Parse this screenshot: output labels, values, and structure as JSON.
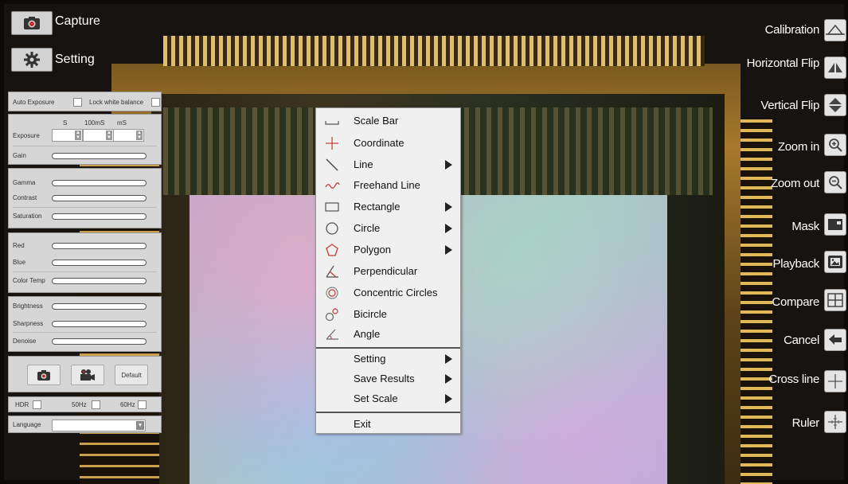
{
  "top_buttons": {
    "capture_label": "Capture",
    "setting_label": "Setting"
  },
  "left_panel": {
    "auto_exposure": "Auto Exposure",
    "lock_white_balance": "Lock white balance",
    "exposure": "Exposure",
    "exposure_units": [
      "S",
      "100mS",
      "mS"
    ],
    "gain": "Gain",
    "gamma": "Gamma",
    "contrast": "Contrast",
    "saturation": "Saturation",
    "red": "Red",
    "blue": "Blue",
    "color_temp": "Color Temp",
    "brightness": "Brightness",
    "sharpness": "Sharpness",
    "denoise": "Denoise",
    "default_button": "Default",
    "hdr": "HDR",
    "hz50": "50Hz",
    "hz60": "60Hz",
    "language": "Language"
  },
  "right_toolbar": {
    "calibration": "Calibration",
    "horizontal_flip": "Horizontal Flip",
    "vertical_flip": "Vertical Flip",
    "zoom_in": "Zoom in",
    "zoom_out": "Zoom out",
    "mask": "Mask",
    "playback": "Playback",
    "compare": "Compare",
    "cancel": "Cancel",
    "cross_line": "Cross line",
    "ruler": "Ruler"
  },
  "menu": {
    "items": [
      {
        "label": "Scale Bar",
        "icon": "scale-bar-icon"
      },
      {
        "label": "Coordinate",
        "icon": "coordinate-icon"
      },
      {
        "label": "Line",
        "icon": "line-icon"
      },
      {
        "label": "Freehand Line",
        "icon": "freehand-line-icon"
      },
      {
        "label": "Rectangle",
        "icon": "rectangle-icon"
      },
      {
        "label": "Circle",
        "icon": "circle-icon"
      },
      {
        "label": "Polygon",
        "icon": "polygon-icon"
      },
      {
        "label": "Perpendicular",
        "icon": "perpendicular-icon"
      },
      {
        "label": "Concentric Circles",
        "icon": "concentric-circles-icon"
      },
      {
        "label": "Bicircle",
        "icon": "bicircle-icon"
      },
      {
        "label": "Angle",
        "icon": "angle-icon"
      }
    ],
    "setting": "Setting",
    "save_results": "Save Results",
    "set_scale": "Set Scale",
    "exit": "Exit"
  },
  "colors": {
    "menu_icon_red": "#c83a3a",
    "toolbar_icon_bg": "#e4e4e4"
  }
}
